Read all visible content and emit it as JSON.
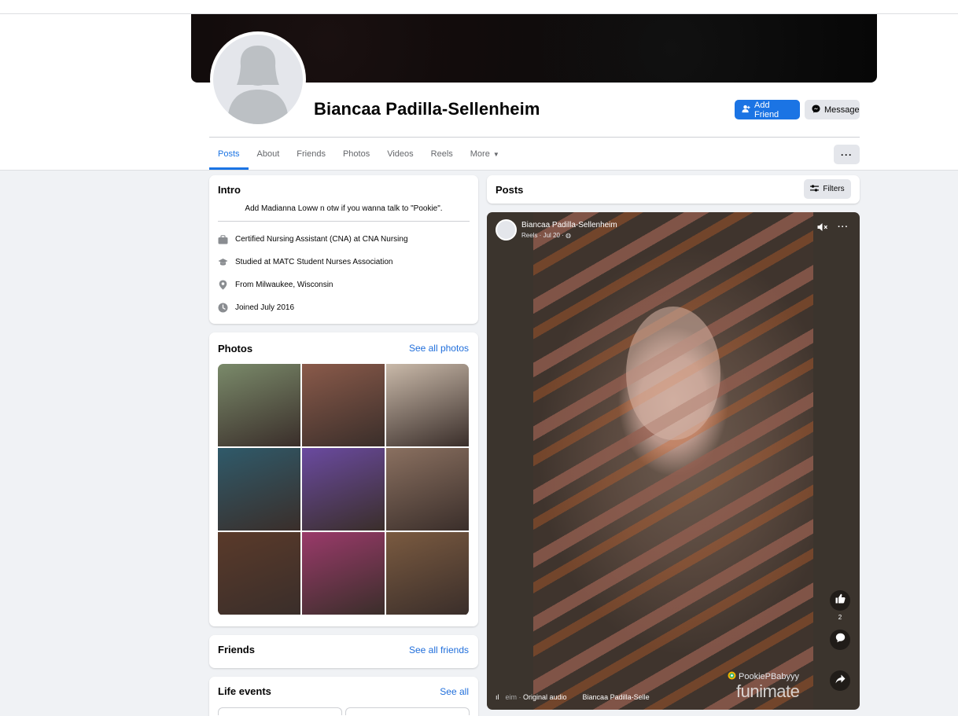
{
  "profile": {
    "name": "Biancaa Padilla-Sellenheim",
    "add_friend_label": "Add Friend",
    "message_label": "Message"
  },
  "tabs": [
    {
      "label": "Posts",
      "active": true
    },
    {
      "label": "About"
    },
    {
      "label": "Friends"
    },
    {
      "label": "Photos"
    },
    {
      "label": "Videos"
    },
    {
      "label": "Reels"
    },
    {
      "label": "More"
    }
  ],
  "more_menu_icon": "ellipsis-icon",
  "intro": {
    "title": "Intro",
    "bio": "Add Madianna Loww n otw if you wanna talk to \"Pookie\".",
    "rows": [
      {
        "icon": "briefcase-icon",
        "prefix": "Certified Nursing Assistant (CNA) at ",
        "value": "CNA Nursing"
      },
      {
        "icon": "graduation-cap-icon",
        "prefix": "Studied at ",
        "value": "MATC Student Nurses Association"
      },
      {
        "icon": "location-pin-icon",
        "prefix": "From ",
        "value": "Milwaukee, Wisconsin"
      },
      {
        "icon": "clock-icon",
        "prefix": "Joined ",
        "value": "July 2016"
      }
    ]
  },
  "photos": {
    "title": "Photos",
    "see_all": "See all photos",
    "tiles": [
      "#7a8a6a",
      "#8a5a4a",
      "#c9b9a9",
      "#2f5a6a",
      "#6a4aa0",
      "#8a7060",
      "#5a3a2a",
      "#9a3a6a",
      "#7a5a40"
    ]
  },
  "friends": {
    "title": "Friends",
    "see_all": "See all friends"
  },
  "life_events": {
    "title": "Life events",
    "see_all": "See all"
  },
  "posts": {
    "title": "Posts",
    "filters_label": "Filters"
  },
  "reel": {
    "author": "Biancaa Padilla-Sellenheim",
    "meta": "Reels · Jul 20 · ",
    "like_count": "2",
    "watermark_user": "PookiePBabyyy",
    "watermark_brand": "funimate",
    "audio_fade": "eim · ",
    "audio_label": "Original audio",
    "audio_author": "Biancaa Padilla-Selle"
  },
  "colors": {
    "accent": "#1b74e4",
    "link": "#216fdb",
    "secondary_button": "#e4e6eb",
    "page_bg": "#f0f2f5"
  }
}
